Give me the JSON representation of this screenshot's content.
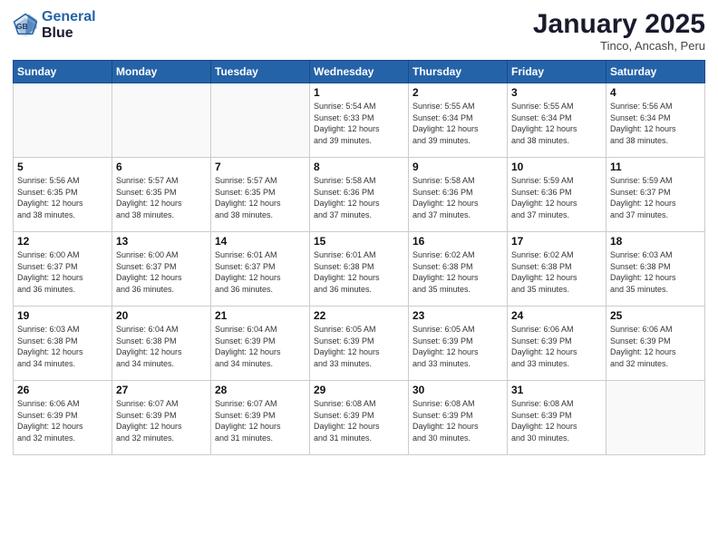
{
  "header": {
    "logo_line1": "General",
    "logo_line2": "Blue",
    "month": "January 2025",
    "location": "Tinco, Ancash, Peru"
  },
  "weekdays": [
    "Sunday",
    "Monday",
    "Tuesday",
    "Wednesday",
    "Thursday",
    "Friday",
    "Saturday"
  ],
  "weeks": [
    [
      {
        "day": "",
        "info": ""
      },
      {
        "day": "",
        "info": ""
      },
      {
        "day": "",
        "info": ""
      },
      {
        "day": "1",
        "info": "Sunrise: 5:54 AM\nSunset: 6:33 PM\nDaylight: 12 hours\nand 39 minutes."
      },
      {
        "day": "2",
        "info": "Sunrise: 5:55 AM\nSunset: 6:34 PM\nDaylight: 12 hours\nand 39 minutes."
      },
      {
        "day": "3",
        "info": "Sunrise: 5:55 AM\nSunset: 6:34 PM\nDaylight: 12 hours\nand 38 minutes."
      },
      {
        "day": "4",
        "info": "Sunrise: 5:56 AM\nSunset: 6:34 PM\nDaylight: 12 hours\nand 38 minutes."
      }
    ],
    [
      {
        "day": "5",
        "info": "Sunrise: 5:56 AM\nSunset: 6:35 PM\nDaylight: 12 hours\nand 38 minutes."
      },
      {
        "day": "6",
        "info": "Sunrise: 5:57 AM\nSunset: 6:35 PM\nDaylight: 12 hours\nand 38 minutes."
      },
      {
        "day": "7",
        "info": "Sunrise: 5:57 AM\nSunset: 6:35 PM\nDaylight: 12 hours\nand 38 minutes."
      },
      {
        "day": "8",
        "info": "Sunrise: 5:58 AM\nSunset: 6:36 PM\nDaylight: 12 hours\nand 37 minutes."
      },
      {
        "day": "9",
        "info": "Sunrise: 5:58 AM\nSunset: 6:36 PM\nDaylight: 12 hours\nand 37 minutes."
      },
      {
        "day": "10",
        "info": "Sunrise: 5:59 AM\nSunset: 6:36 PM\nDaylight: 12 hours\nand 37 minutes."
      },
      {
        "day": "11",
        "info": "Sunrise: 5:59 AM\nSunset: 6:37 PM\nDaylight: 12 hours\nand 37 minutes."
      }
    ],
    [
      {
        "day": "12",
        "info": "Sunrise: 6:00 AM\nSunset: 6:37 PM\nDaylight: 12 hours\nand 36 minutes."
      },
      {
        "day": "13",
        "info": "Sunrise: 6:00 AM\nSunset: 6:37 PM\nDaylight: 12 hours\nand 36 minutes."
      },
      {
        "day": "14",
        "info": "Sunrise: 6:01 AM\nSunset: 6:37 PM\nDaylight: 12 hours\nand 36 minutes."
      },
      {
        "day": "15",
        "info": "Sunrise: 6:01 AM\nSunset: 6:38 PM\nDaylight: 12 hours\nand 36 minutes."
      },
      {
        "day": "16",
        "info": "Sunrise: 6:02 AM\nSunset: 6:38 PM\nDaylight: 12 hours\nand 35 minutes."
      },
      {
        "day": "17",
        "info": "Sunrise: 6:02 AM\nSunset: 6:38 PM\nDaylight: 12 hours\nand 35 minutes."
      },
      {
        "day": "18",
        "info": "Sunrise: 6:03 AM\nSunset: 6:38 PM\nDaylight: 12 hours\nand 35 minutes."
      }
    ],
    [
      {
        "day": "19",
        "info": "Sunrise: 6:03 AM\nSunset: 6:38 PM\nDaylight: 12 hours\nand 34 minutes."
      },
      {
        "day": "20",
        "info": "Sunrise: 6:04 AM\nSunset: 6:38 PM\nDaylight: 12 hours\nand 34 minutes."
      },
      {
        "day": "21",
        "info": "Sunrise: 6:04 AM\nSunset: 6:39 PM\nDaylight: 12 hours\nand 34 minutes."
      },
      {
        "day": "22",
        "info": "Sunrise: 6:05 AM\nSunset: 6:39 PM\nDaylight: 12 hours\nand 33 minutes."
      },
      {
        "day": "23",
        "info": "Sunrise: 6:05 AM\nSunset: 6:39 PM\nDaylight: 12 hours\nand 33 minutes."
      },
      {
        "day": "24",
        "info": "Sunrise: 6:06 AM\nSunset: 6:39 PM\nDaylight: 12 hours\nand 33 minutes."
      },
      {
        "day": "25",
        "info": "Sunrise: 6:06 AM\nSunset: 6:39 PM\nDaylight: 12 hours\nand 32 minutes."
      }
    ],
    [
      {
        "day": "26",
        "info": "Sunrise: 6:06 AM\nSunset: 6:39 PM\nDaylight: 12 hours\nand 32 minutes."
      },
      {
        "day": "27",
        "info": "Sunrise: 6:07 AM\nSunset: 6:39 PM\nDaylight: 12 hours\nand 32 minutes."
      },
      {
        "day": "28",
        "info": "Sunrise: 6:07 AM\nSunset: 6:39 PM\nDaylight: 12 hours\nand 31 minutes."
      },
      {
        "day": "29",
        "info": "Sunrise: 6:08 AM\nSunset: 6:39 PM\nDaylight: 12 hours\nand 31 minutes."
      },
      {
        "day": "30",
        "info": "Sunrise: 6:08 AM\nSunset: 6:39 PM\nDaylight: 12 hours\nand 30 minutes."
      },
      {
        "day": "31",
        "info": "Sunrise: 6:08 AM\nSunset: 6:39 PM\nDaylight: 12 hours\nand 30 minutes."
      },
      {
        "day": "",
        "info": ""
      }
    ]
  ]
}
